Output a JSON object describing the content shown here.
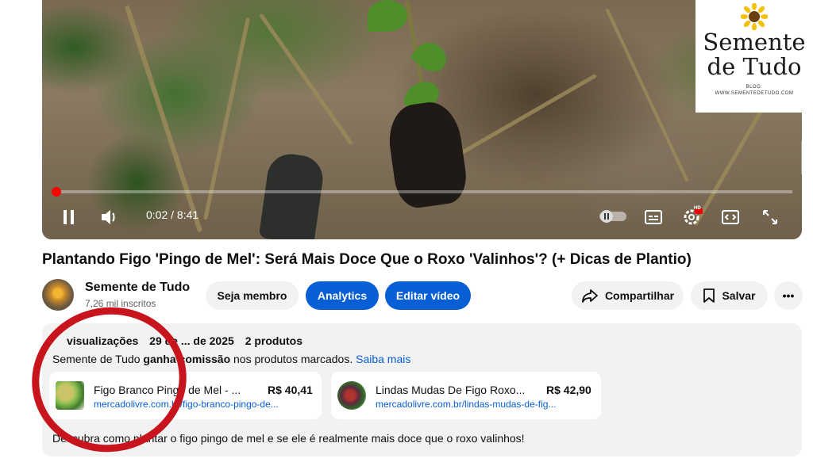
{
  "player": {
    "time": "0:02 / 8:41",
    "progress_fraction": 0.004,
    "icons": [
      "pause-icon",
      "volume-icon",
      "autoplay-toggle-icon",
      "subtitles-icon",
      "settings-icon",
      "miniplayer-icon",
      "fullscreen-icon"
    ]
  },
  "watermark": {
    "title_line1": "Semente",
    "title_line2": "de Tudo",
    "sub_line1": "BLOG:",
    "sub_line2": "WWW.SEMENTEDETUDO.COM",
    "hd_badge": "HD"
  },
  "video": {
    "title": "Plantando Figo 'Pingo de Mel': Será Mais Doce Que o Roxo 'Valinhos'? (+ Dicas de Plantio)"
  },
  "channel": {
    "name": "Semente de Tudo",
    "subscribers": "7,26 mil inscritos"
  },
  "actions": {
    "join": "Seja membro",
    "analytics": "Analytics",
    "edit": "Editar vídeo",
    "share": "Compartilhar",
    "save": "Salvar",
    "more": "•••"
  },
  "description": {
    "views": "visualizações",
    "date": "29 de ... de 2025",
    "products_count": "2 produtos",
    "commission_prefix": "Semente de Tudo",
    "commission_bold": "ganha comissão",
    "commission_suffix": "nos produtos marcados.",
    "learn_more": "Saiba mais",
    "text": "Descubra como plantar o figo pingo de mel e se ele é realmente mais doce que o roxo valinhos!"
  },
  "products": [
    {
      "name": "Figo Branco Pingo de Mel - ...",
      "price": "R$ 40,41",
      "url": "mercadolivre.com.br/figo-branco-pingo-de..."
    },
    {
      "name": "Lindas Mudas De Figo Roxo...",
      "price": "R$ 42,90",
      "url": "mercadolivre.com.br/lindas-mudas-de-fig..."
    }
  ],
  "colors": {
    "accent_blue": "#065fd4",
    "progress_red": "#ff0000",
    "annotation_red": "#c8141c"
  }
}
